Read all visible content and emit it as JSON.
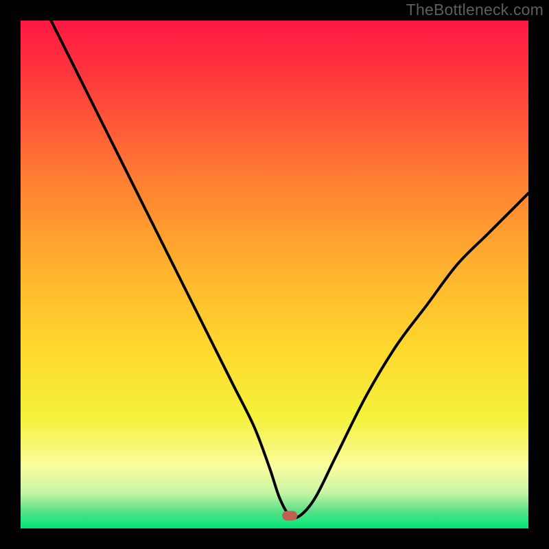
{
  "watermark": "TheBottleneck.com",
  "chart_data": {
    "type": "line",
    "title": "",
    "xlabel": "",
    "ylabel": "",
    "xlim": [
      0,
      100
    ],
    "ylim": [
      0,
      100
    ],
    "background_gradient": {
      "orientation": "vertical",
      "stops": [
        {
          "offset": 0.0,
          "color": "#ff1744"
        },
        {
          "offset": 0.12,
          "color": "#ff3b3b"
        },
        {
          "offset": 0.3,
          "color": "#ff7a33"
        },
        {
          "offset": 0.48,
          "color": "#ffb02e"
        },
        {
          "offset": 0.65,
          "color": "#ffd92e"
        },
        {
          "offset": 0.78,
          "color": "#f4f23a"
        },
        {
          "offset": 0.88,
          "color": "#f9fca0"
        },
        {
          "offset": 0.93,
          "color": "#c6f5a4"
        },
        {
          "offset": 0.965,
          "color": "#5de08a"
        },
        {
          "offset": 1.0,
          "color": "#00e676"
        }
      ]
    },
    "marker": {
      "x": 53,
      "y": 2.5,
      "color": "#c06055"
    },
    "series": [
      {
        "name": "bottleneck-curve",
        "color": "#000000",
        "x": [
          6,
          10,
          14,
          18,
          22,
          26,
          30,
          34,
          38,
          42,
          46,
          49,
          51,
          53,
          55,
          58,
          62,
          68,
          74,
          80,
          86,
          92,
          98,
          100
        ],
        "y": [
          100,
          92,
          84,
          76,
          68,
          60,
          52,
          44,
          36,
          28,
          20,
          12,
          6,
          2.5,
          2.5,
          6,
          14,
          26,
          36,
          44,
          52,
          58,
          64,
          66
        ]
      }
    ]
  }
}
